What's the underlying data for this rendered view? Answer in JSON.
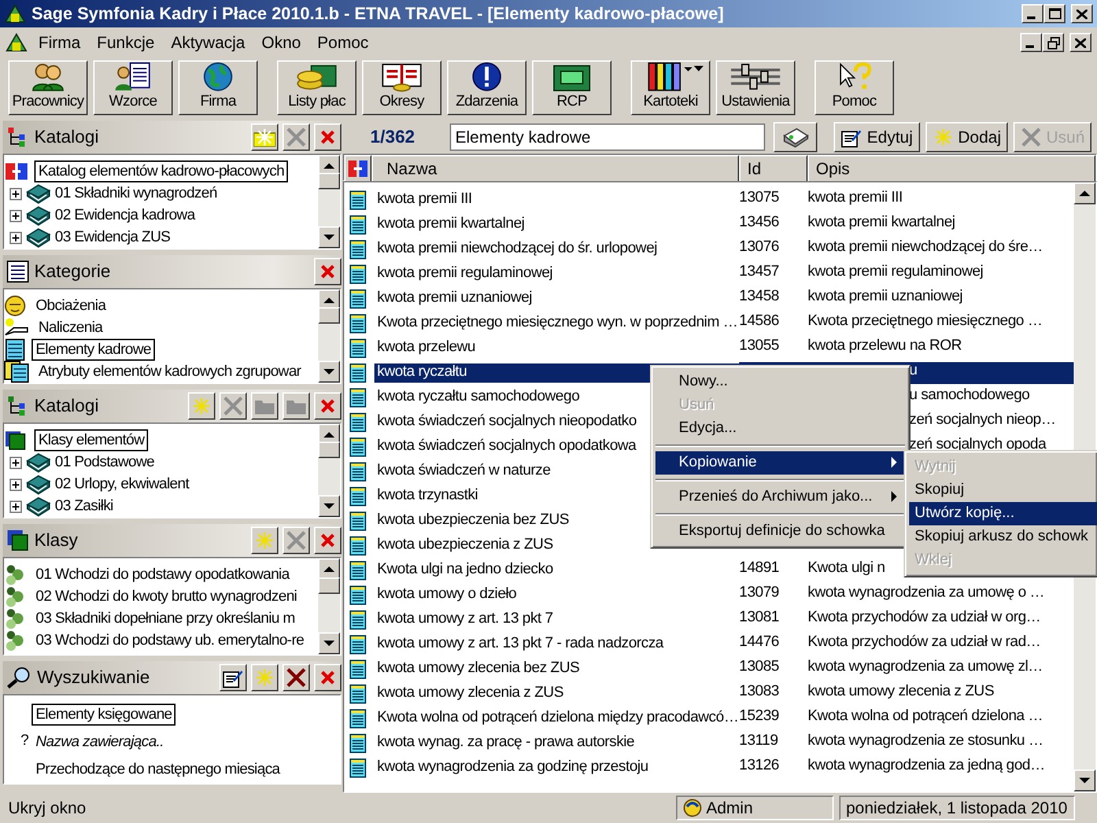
{
  "window": {
    "title": "Sage Symfonia Kadry i Płace 2010.1.b - ETNA TRAVEL - [Elementy kadrowo-płacowe]"
  },
  "menu": [
    "Firma",
    "Funkcje",
    "Aktywacja",
    "Okno",
    "Pomoc"
  ],
  "toolbar": [
    [
      {
        "label": "Pracownicy"
      },
      {
        "label": "Wzorce"
      },
      {
        "label": "Firma"
      }
    ],
    [
      {
        "label": "Listy płac"
      },
      {
        "label": "Okresy"
      },
      {
        "label": "Zdarzenia"
      },
      {
        "label": "RCP"
      }
    ],
    [
      {
        "label": "Kartoteki",
        "dropdown": true
      },
      {
        "label": "Ustawienia"
      }
    ],
    [
      {
        "label": "Pomoc"
      }
    ]
  ],
  "panels": [
    {
      "title": "Katalogi",
      "kind": "tree",
      "tools": [
        {
          "kind": "add_folder",
          "disabled": false
        },
        {
          "kind": "remove_folder",
          "disabled": true
        },
        {
          "kind": "close",
          "disabled": false
        }
      ],
      "root": {
        "label": "Katalog elementów kadrowo-płacowych",
        "selected": true
      },
      "items": [
        {
          "label": "01 Składniki wynagrodzeń",
          "expanded": false
        },
        {
          "label": "02 Ewidencja kadrowa",
          "expanded": false
        },
        {
          "label": "03 Ewidencja ZUS",
          "expanded": false
        }
      ]
    },
    {
      "title": "Kategorie",
      "kind": "list",
      "tools": [
        {
          "kind": "close",
          "disabled": false
        }
      ],
      "items": [
        {
          "label": "Obciażenia",
          "selected": false
        },
        {
          "label": "Naliczenia",
          "selected": false
        },
        {
          "label": "Elementy kadrowe",
          "selected": true
        },
        {
          "label": "Atrybuty elementów kadrowych zgrupowar",
          "selected": false
        }
      ]
    },
    {
      "title": "Katalogi",
      "kind": "tree",
      "tools": [
        {
          "kind": "add",
          "disabled": false
        },
        {
          "kind": "delete",
          "disabled": true
        },
        {
          "kind": "folder",
          "disabled": true
        },
        {
          "kind": "folder",
          "disabled": true
        },
        {
          "kind": "close",
          "disabled": false
        }
      ],
      "root": {
        "label": "Klasy elementów",
        "selected": true
      },
      "items": [
        {
          "label": "01 Podstawowe",
          "expanded": false
        },
        {
          "label": "02 Urlopy, ekwiwalent",
          "expanded": false
        },
        {
          "label": "03 Zasiłki",
          "expanded": false
        }
      ]
    },
    {
      "title": "Klasy",
      "kind": "list",
      "tools": [
        {
          "kind": "add",
          "disabled": false
        },
        {
          "kind": "delete",
          "disabled": true
        },
        {
          "kind": "close",
          "disabled": false
        }
      ],
      "items": [
        {
          "label": "01 Wchodzi do podstawy opodatkowania",
          "selected": false
        },
        {
          "label": "02 Wchodzi do kwoty brutto wynagrodzeni",
          "selected": false
        },
        {
          "label": "03 Składniki dopełniane przy określaniu m",
          "selected": false
        },
        {
          "label": "03 Wchodzi do podstawy ub. emerytalno-re",
          "selected": false
        }
      ]
    },
    {
      "title": "Wyszukiwanie",
      "kind": "search",
      "tools": [
        {
          "kind": "edit",
          "disabled": false
        },
        {
          "kind": "add",
          "disabled": false
        },
        {
          "kind": "delete",
          "disabled": false
        },
        {
          "kind": "close",
          "disabled": false
        }
      ],
      "items": [
        {
          "kind": "saved",
          "label": "Elementy księgowane",
          "selected": true
        },
        {
          "kind": "query",
          "marker": "?",
          "label": "Nazwa zawierająca..",
          "selected": false
        },
        {
          "kind": "saved",
          "label": "Przechodzące do następnego miesiąca",
          "selected": false
        }
      ]
    }
  ],
  "hide_pane": "Ukryj okno",
  "counter": "1/362",
  "filter": {
    "value": "Elementy kadrowe"
  },
  "actions": [
    {
      "label": "Edytuj",
      "kind": "edit",
      "disabled": false
    },
    {
      "label": "Dodaj",
      "kind": "add",
      "disabled": false
    },
    {
      "label": "Usuń",
      "kind": "delete",
      "disabled": true
    }
  ],
  "table": {
    "columns": [
      "Nazwa",
      "Id",
      "Opis"
    ],
    "rows": [
      {
        "name": "kwota premii III",
        "id": "13075",
        "opis": "kwota premii III",
        "selected": false
      },
      {
        "name": "kwota premii kwartalnej",
        "id": "13456",
        "opis": "kwota premii kwartalnej",
        "selected": false
      },
      {
        "name": "kwota premii niewchodzącej do śr. urlopowej",
        "id": "13076",
        "opis": "kwota premii niewchodzącej do śre…",
        "selected": false
      },
      {
        "name": "kwota premii regulaminowej",
        "id": "13457",
        "opis": "kwota premii regulaminowej",
        "selected": false
      },
      {
        "name": "kwota premii uznaniowej",
        "id": "13458",
        "opis": "kwota premii uznaniowej",
        "selected": false
      },
      {
        "name": "Kwota przeciętnego miesięcznego wyn. w poprzednim …",
        "id": "14586",
        "opis": "Kwota przeciętnego miesięcznego …",
        "selected": false
      },
      {
        "name": "kwota przelewu",
        "id": "13055",
        "opis": "kwota przelewu na ROR",
        "selected": false
      },
      {
        "name": "kwota ryczałtu",
        "opis": "u",
        "covered": true,
        "selected": true
      },
      {
        "name": "kwota ryczałtu samochodowego",
        "opis": "u samochodowego",
        "covered": true,
        "selected": false
      },
      {
        "name": "kwota świadczeń socjalnych nieopodatko",
        "opis": "zeń socjalnych nieop…",
        "covered": true,
        "selected": false
      },
      {
        "name": "kwota świadczeń socjalnych opodatkowa",
        "opis": "zeń socjalnych opoda",
        "covered": true,
        "selected": false
      },
      {
        "name": "kwota świadczeń w naturze",
        "selected": false
      },
      {
        "name": "kwota trzynastki",
        "selected": false
      },
      {
        "name": "kwota ubezpieczenia bez ZUS",
        "selected": false
      },
      {
        "name": "kwota ubezpieczenia z ZUS",
        "selected": false
      },
      {
        "name": "Kwota ulgi na jedno dziecko",
        "id": "14891",
        "opis": "Kwota ulgi n",
        "selected": false
      },
      {
        "name": "kwota umowy o dzieło",
        "id": "13079",
        "opis": "kwota wynagrodzenia za umowę o …",
        "selected": false
      },
      {
        "name": "kwota umowy z art. 13 pkt 7",
        "id": "13081",
        "opis": "Kwota przychodów za udział w org…",
        "selected": false
      },
      {
        "name": "kwota umowy z art. 13 pkt 7 - rada nadzorcza",
        "id": "14476",
        "opis": "Kwota przychodów za udział w rad…",
        "selected": false
      },
      {
        "name": "kwota umowy zlecenia bez ZUS",
        "id": "13085",
        "opis": "kwota wynagrodzenia za umowę zl…",
        "selected": false
      },
      {
        "name": "kwota umowy zlecenia z ZUS",
        "id": "13083",
        "opis": "kwota umowy zlecenia z ZUS",
        "selected": false
      },
      {
        "name": "Kwota wolna od potrąceń dzielona między pracodawcó…",
        "id": "15239",
        "opis": "Kwota wolna od potrąceń dzielona …",
        "selected": false
      },
      {
        "name": "kwota wynag. za pracę - prawa autorskie",
        "id": "13119",
        "opis": "kwota wynagrodzenia ze stosunku …",
        "selected": false
      },
      {
        "name": "kwota wynagrodzenia za godzinę przestoju",
        "id": "13126",
        "opis": "kwota wynagrodzenia za jedną god…",
        "selected": false
      }
    ]
  },
  "context_menu": {
    "items": [
      {
        "kind": "item",
        "label": "Nowy...",
        "disabled": false,
        "selected": false
      },
      {
        "kind": "item",
        "label": "Usuń",
        "disabled": true,
        "selected": false
      },
      {
        "kind": "item",
        "label": "Edycja...",
        "disabled": false,
        "selected": false
      },
      {
        "kind": "separator"
      },
      {
        "kind": "item",
        "label": "Kopiowanie",
        "disabled": false,
        "selected": true,
        "submenu": true
      },
      {
        "kind": "separator"
      },
      {
        "kind": "item",
        "label": "Przenieś do Archiwum jako...",
        "disabled": false,
        "selected": false,
        "submenu": true
      },
      {
        "kind": "separator"
      },
      {
        "kind": "item",
        "label": "Eksportuj definicje do schowka",
        "disabled": false,
        "selected": false
      }
    ]
  },
  "submenu": {
    "items": [
      {
        "label": "Wytnij",
        "disabled": true,
        "selected": false
      },
      {
        "label": "Skopiuj",
        "disabled": false,
        "selected": false
      },
      {
        "label": "Utwórz kopię...",
        "disabled": false,
        "selected": true
      },
      {
        "label": "Skopiuj arkusz do schowk",
        "disabled": false,
        "selected": false
      },
      {
        "label": "Wklej",
        "disabled": true,
        "selected": false
      }
    ]
  },
  "status_bar": {
    "user": "Admin",
    "date": "poniedziałek, 1 listopada 2010"
  }
}
